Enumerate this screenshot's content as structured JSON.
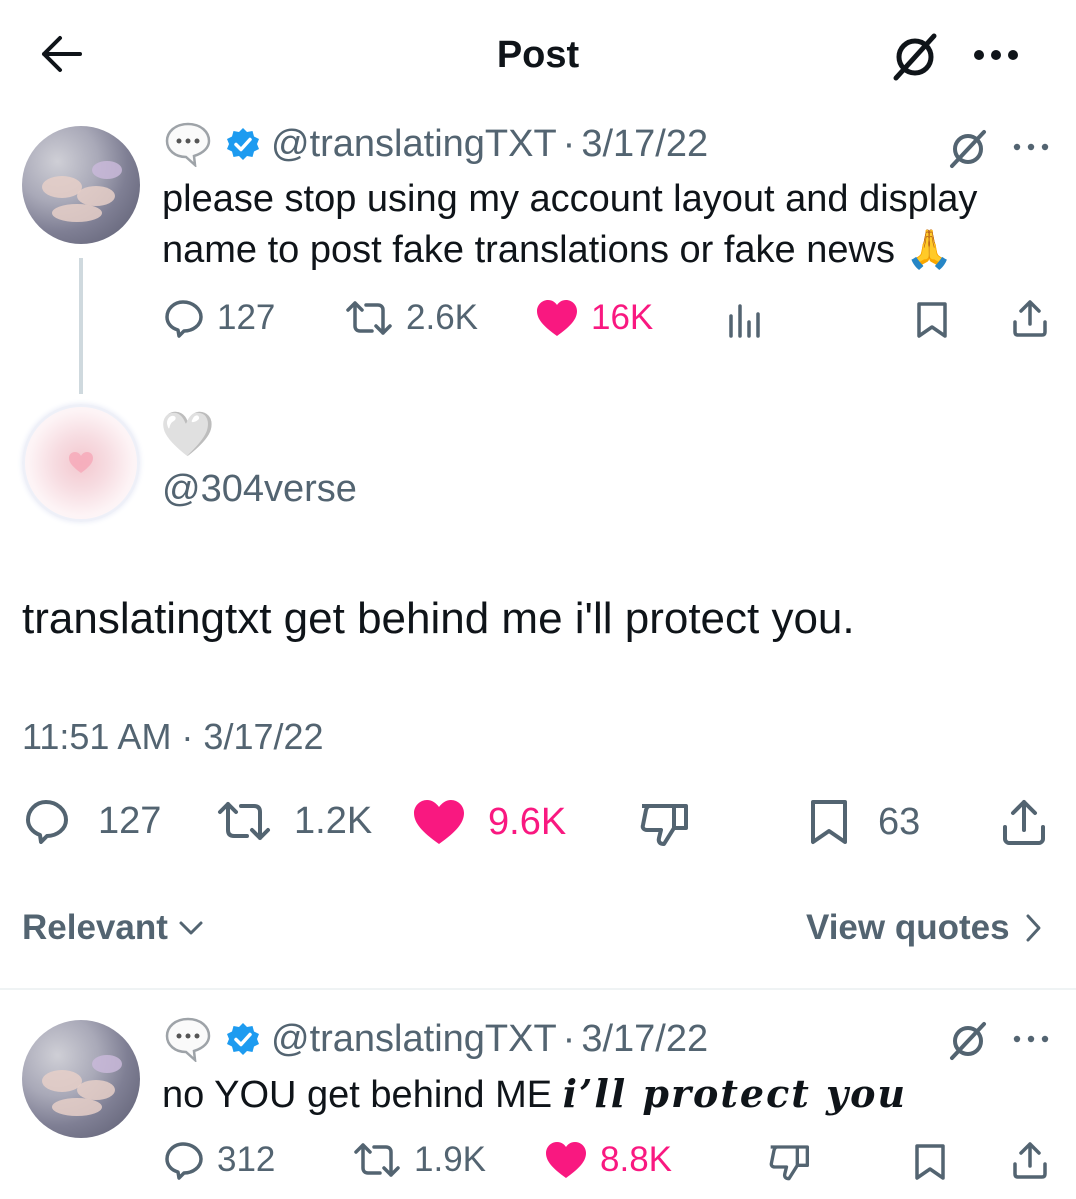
{
  "header": {
    "title": "Post",
    "back_icon": "arrow-left-icon",
    "grok_icon": "grok-icon",
    "more_icon": "more-icon"
  },
  "quoted_tweet": {
    "handle": "@translatingTXT",
    "separator": "·",
    "date": "3/17/22",
    "text": "please stop using my account layout and display name to post fake translations or fake news 🙏",
    "stats": {
      "replies": "127",
      "retweets": "2.6K",
      "likes": "16K"
    }
  },
  "main_tweet": {
    "display_name_emoji": "🤍",
    "handle": "@304verse",
    "text": "translatingtxt get behind me i'll protect you.",
    "timestamp": "11:51 AM · 3/17/22",
    "stats": {
      "replies": "127",
      "retweets": "1.2K",
      "likes": "9.6K",
      "bookmarks": "63"
    }
  },
  "filters": {
    "sort_label": "Relevant",
    "view_quotes_label": "View quotes"
  },
  "reply_tweet": {
    "handle": "@translatingTXT",
    "separator": "·",
    "date": "3/17/22",
    "text_plain": "no YOU get behind ME ",
    "text_styled": "i’ll protect you",
    "stats": {
      "replies": "312",
      "retweets": "1.9K",
      "likes": "8.8K"
    }
  },
  "colors": {
    "accent_pink": "#f91880",
    "verified_blue": "#1d9bf0",
    "text_gray": "#536471"
  }
}
